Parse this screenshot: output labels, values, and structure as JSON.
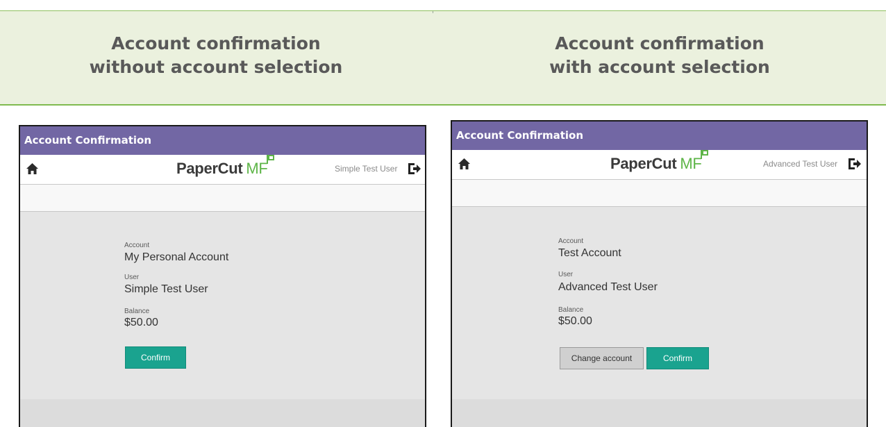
{
  "banner": {
    "left_title": [
      "Account confirmation",
      "without account selection"
    ],
    "right_title": [
      "Account confirmation",
      "with account selection"
    ]
  },
  "left_panel": {
    "header_title": "Account Confirmation",
    "logo_main": "PaperCut",
    "logo_suffix": "MF",
    "user_name": "Simple Test User",
    "fields": {
      "account_label": "Account",
      "account_value": "My Personal Account",
      "user_label": "User",
      "user_value": "Simple Test User",
      "balance_label": "Balance",
      "balance_value": "$50.00"
    },
    "buttons": {
      "confirm": "Confirm"
    }
  },
  "right_panel": {
    "header_title": "Account Confirmation",
    "logo_main": "PaperCut",
    "logo_suffix": "MF",
    "user_name": "Advanced Test User",
    "fields": {
      "account_label": "Account",
      "account_value": "Test Account",
      "user_label": "User",
      "user_value": "Advanced Test User",
      "balance_label": "Balance",
      "balance_value": "$50.00"
    },
    "buttons": {
      "change_account": "Change account",
      "confirm": "Confirm"
    }
  },
  "icons": {
    "home": "home-icon",
    "logout": "logout-icon",
    "logo_flag": "flag-icon"
  },
  "colors": {
    "header_purple": "#7267a4",
    "confirm_teal": "#1aa38f",
    "brand_green": "#5eb548",
    "banner_bg": "#ebf1de"
  }
}
